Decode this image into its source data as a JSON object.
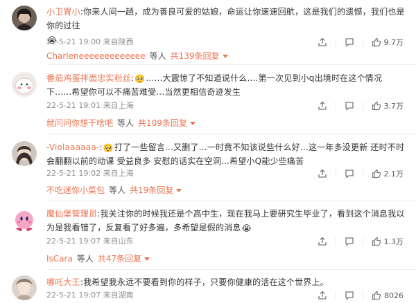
{
  "comments": [
    {
      "user": "小卫胃小",
      "sep": ":",
      "text": "你来人间一趟，成为善良可爱的姑娘，命运让你速速回航，这是我们的遗憾，我们也是你的过往",
      "emoji": "😭",
      "date": "22-5-21 19:00",
      "source": "来自陕西",
      "likes": "9.7万",
      "reply_user": "Charleneeeeeeeeeeeee",
      "reply_mid": "等人",
      "reply_total": "共139条回复"
    },
    {
      "user": "番茄鸡蛋拌面忠实粉丝",
      "sep": ":",
      "emoji_lead": "🥺",
      "text": "......大震惊了不知道说什么....第一次见到小q出境时在这个情况下......希望你可以不痛苦难受...当然更相信奇迹发生",
      "date": "22-5-21 19:01",
      "source": "来自上海",
      "likes": "3.7万",
      "reply_user": "就问问你想干啥吧",
      "reply_mid": "等人",
      "reply_total": "共109条回复"
    },
    {
      "user": "-Violaaaaaa-",
      "sep": ":",
      "emoji_lead": "🥺",
      "text": "打了一些留言...又删了...一时竟不知该说些什么好...这一年多没更新 还时不时会翻翻以前的动课 受益良多 安慰的话实在空洞...希望小Q能少些痛苦",
      "date": "22-5-21 19:02",
      "source": "来自上海",
      "likes": "2.1万",
      "reply_user": "不吃迷你小菜包",
      "reply_mid": "等人",
      "reply_total": "共19条回复"
    },
    {
      "user": "魔仙堡管理员",
      "sep": ":",
      "text": "我关注你的时候我还是个高中生，现在我马上要研究生毕业了，看到这个消息我以为是我看错了，反复看了好多遍，多希望是假的消息",
      "emoji": "😭",
      "date": "22-5-21 19:07",
      "source": "来自山东",
      "likes": "1.3万",
      "reply_user": "IsCara",
      "reply_mid": "等人",
      "reply_total": "共47条回复"
    },
    {
      "user": "哪吒大王",
      "sep": ":",
      "text": "我希望我永远不要看到你的样子，只要你健康的活在这个世界上。",
      "date": "22-5-21 19:07",
      "source": "来自湖南",
      "likes": "8026"
    }
  ]
}
